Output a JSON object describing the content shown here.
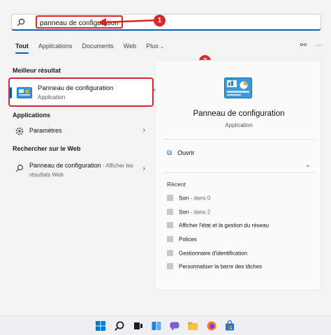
{
  "search": {
    "query": "panneau de configuration"
  },
  "annotations": {
    "badge1": "1",
    "badge2": "2"
  },
  "tabs": [
    {
      "label": "Tout"
    },
    {
      "label": "Applications"
    },
    {
      "label": "Documents"
    },
    {
      "label": "Web"
    },
    {
      "label": "Plus"
    }
  ],
  "left": {
    "best_header": "Meilleur résultat",
    "best": {
      "title": "Panneau de configuration",
      "sub": "Application"
    },
    "apps_header": "Applications",
    "apps": [
      {
        "label": "Paramètres"
      }
    ],
    "web_header": "Rechercher sur le Web",
    "web": {
      "label": "Panneau de configuration",
      "hint": " - Afficher les résultats Web"
    }
  },
  "panel": {
    "title": "Panneau de configuration",
    "sub": "Application",
    "open": "Ouvrir",
    "recent_header": "Récent",
    "recent": [
      {
        "label": "Son",
        "hint": " - dans 0"
      },
      {
        "label": "Son",
        "hint": " - dans 2"
      },
      {
        "label": "Afficher l'état et la gestion du réseau",
        "hint": ""
      },
      {
        "label": "Polices",
        "hint": ""
      },
      {
        "label": "Gestionnaire d'identification",
        "hint": ""
      },
      {
        "label": "Personnaliser la barre des tâches",
        "hint": ""
      }
    ]
  },
  "colors": {
    "accent": "#005fb8",
    "annotation_red": "#d9262c"
  },
  "icons": [
    "search-icon",
    "control-panel-icon",
    "gear-icon",
    "search-web-icon",
    "open-icon",
    "share-icon",
    "more-icon"
  ]
}
